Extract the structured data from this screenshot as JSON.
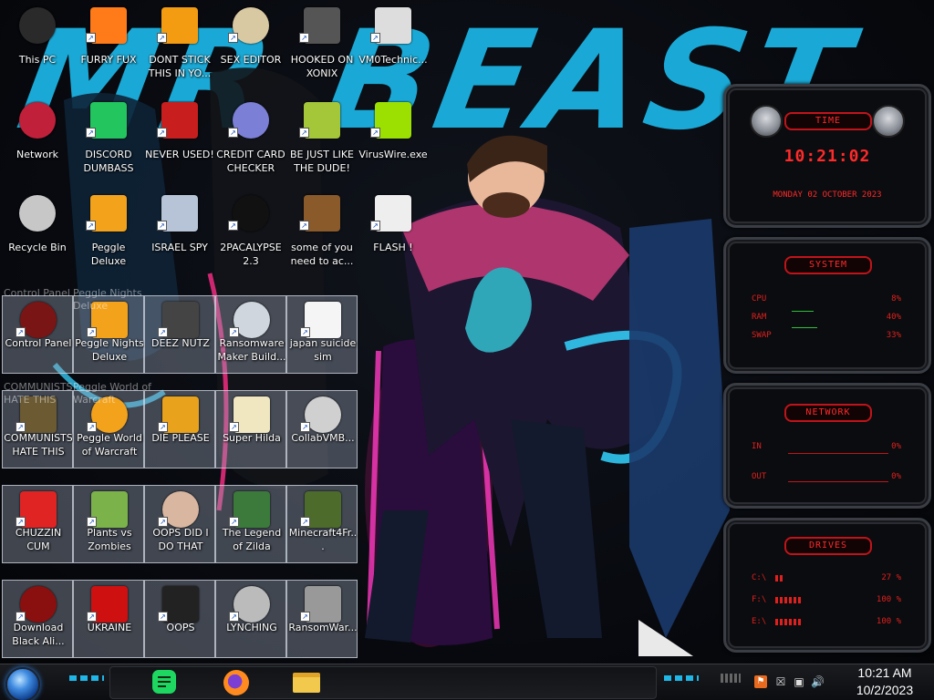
{
  "desktop": {
    "icons": [
      {
        "label": "This PC",
        "icon": "computer-icon"
      },
      {
        "label": "FURRY FUX",
        "icon": "firefox-icon"
      },
      {
        "label": "DONT STICK THIS IN YO...",
        "icon": "vlc-icon"
      },
      {
        "label": "SEX EDITOR",
        "icon": "hxd-editor-icon"
      },
      {
        "label": "HOOKED ON XONIX",
        "icon": "xonix-game-icon"
      },
      {
        "label": "VM0Technic...",
        "icon": "technician-icon"
      },
      {
        "label": "Network",
        "icon": "network-icon"
      },
      {
        "label": "DISCORD DUMBASS",
        "icon": "chat-app-icon"
      },
      {
        "label": "NEVER USED!",
        "icon": "devcpp-icon"
      },
      {
        "label": "CREDIT CARD CHECKER",
        "icon": "credit-card-icon"
      },
      {
        "label": "BE JUST LIKE THE DUDE!",
        "icon": "santa-icon"
      },
      {
        "label": "VirusWire.exe",
        "icon": "lime-icon"
      },
      {
        "label": "Recycle Bin",
        "icon": "recycle-bin-icon"
      },
      {
        "label": "Peggle Deluxe",
        "icon": "peggle-icon"
      },
      {
        "label": "ISRAEL SPY",
        "icon": "spy-icon"
      },
      {
        "label": "2PACALYPSE 2.3",
        "icon": "terminal-icon"
      },
      {
        "label": "some of you need to ac...",
        "icon": "beaver-icon"
      },
      {
        "label": "FLASH !",
        "icon": "flash-icon"
      },
      {
        "label": "Control Panel",
        "icon": "control-panel-icon"
      },
      {
        "label": "Peggle Nights Deluxe",
        "icon": "peggle-nights-icon"
      },
      {
        "label": "DEEZ NUTZ",
        "icon": "stack-icon"
      },
      {
        "label": "Ransomware Maker Build...",
        "icon": "ransomware-builder-icon"
      },
      {
        "label": "japan suicide sim",
        "icon": "document-icon"
      },
      {
        "label": "COMMUNISTS HATE THIS G...",
        "icon": "money-bag-icon"
      },
      {
        "label": "Peggle World of Warcraft",
        "icon": "peggle-wow-icon"
      },
      {
        "label": "DIE PLEASE",
        "icon": "de-icon"
      },
      {
        "label": "Super Hilda",
        "icon": "pixel-dog-icon"
      },
      {
        "label": "CollabVMB...",
        "icon": "collab-vm-icon"
      },
      {
        "label": "CHUZZIN CUM",
        "icon": "chuzzle-icon"
      },
      {
        "label": "Plants vs Zombies",
        "icon": "plants-vs-zombies-icon"
      },
      {
        "label": "OOPS DID I DO THAT",
        "icon": "portrait-icon"
      },
      {
        "label": "The Legend of Zilda",
        "icon": "pixel-hero-icon"
      },
      {
        "label": "Minecraft4Fr...",
        "icon": "minecraft-icon"
      },
      {
        "label": "Download Black Ali...",
        "icon": "black-alien-icon"
      },
      {
        "label": "UKRAINE",
        "icon": "radiation-icon"
      },
      {
        "label": "OOPS",
        "icon": "black-box-icon"
      },
      {
        "label": "LYNCHING",
        "icon": "noose-icon"
      },
      {
        "label": "RansomWar...",
        "icon": "skull-icon"
      }
    ],
    "ghost_labels": [
      "Control Panel",
      "Peggle Nights Deluxe",
      "COMMUNISTS HATE THIS",
      "Peggle World of Warcraft"
    ]
  },
  "wallpaper_text": "MR BEAST",
  "widgets": {
    "time": {
      "title": "TIME",
      "time": "10:21:02",
      "date": "MONDAY 02 OCTOBER 2023"
    },
    "system": {
      "title": "SYSTEM",
      "rows": [
        {
          "label": "CPU",
          "value": "8%"
        },
        {
          "label": "RAM",
          "value": "40%"
        },
        {
          "label": "SWAP",
          "value": "33%"
        }
      ]
    },
    "network": {
      "title": "NETWORK",
      "rows": [
        {
          "label": "IN",
          "value": "0%"
        },
        {
          "label": "OUT",
          "value": "0%"
        }
      ]
    },
    "drives": {
      "title": "DRIVES",
      "rows": [
        {
          "label": "C:\\",
          "value": "27 %",
          "fill": 0.27
        },
        {
          "label": "F:\\",
          "value": "100 %",
          "fill": 1.0
        },
        {
          "label": "E:\\",
          "value": "100 %",
          "fill": 1.0
        }
      ]
    }
  },
  "taskbar": {
    "pinned": [
      {
        "name": "chat-app",
        "icon": "chat-app-icon"
      },
      {
        "name": "firefox",
        "icon": "firefox-icon"
      },
      {
        "name": "file-explorer",
        "icon": "folder-icon"
      }
    ],
    "tray": [
      "flag-icon",
      "red-x-network-icon",
      "network-icon",
      "volume-icon"
    ],
    "clock": {
      "time": "10:21 AM",
      "date": "10/2/2023"
    }
  },
  "colors": {
    "widget_red": "#e0201e",
    "accent_cyan": "#1fb6e8",
    "accent_pink": "#ff2e88"
  }
}
